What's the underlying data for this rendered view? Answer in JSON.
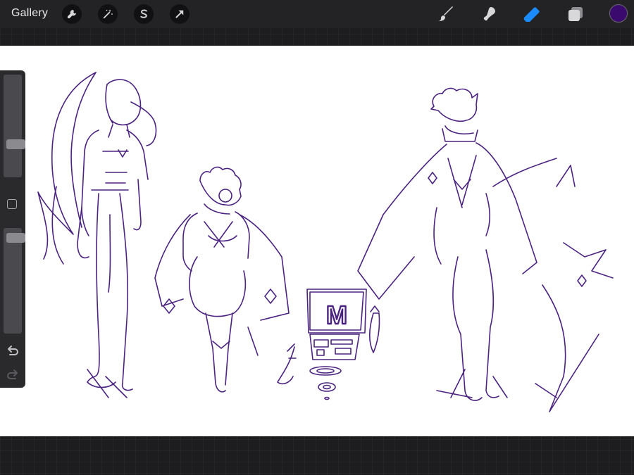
{
  "topbar": {
    "gallery_label": "Gallery",
    "left_tools": [
      "wrench-icon",
      "magic-wand-icon",
      "selection-s-icon",
      "transform-arrow-icon"
    ],
    "right_tools": [
      "brush-icon",
      "smudge-icon",
      "eraser-icon",
      "layers-icon"
    ],
    "active_tool": "eraser-icon",
    "accent_color": "#1a8cff",
    "current_color": "#3a0a6e"
  },
  "canvas": {
    "background": "#ffffff",
    "ink_color": "#4b2380",
    "monitor_glyph": "M"
  },
  "sidebar": {
    "brush_size_level": 0.3,
    "opacity_level": 0.95,
    "controls": [
      "brush-size-slider",
      "modify-button",
      "opacity-slider",
      "undo-icon",
      "redo-icon"
    ]
  }
}
